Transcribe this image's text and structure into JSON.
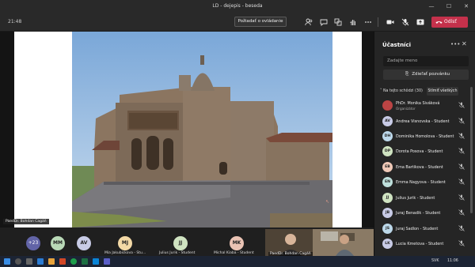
{
  "window": {
    "title": "LD - dejepis - beseda"
  },
  "toolbar": {
    "timer": "21:48",
    "request_label": "Požiadať o ovládanie",
    "leave_label": "Odísť",
    "colors": {
      "leave": "#c4314b"
    }
  },
  "stage": {
    "presenter_tag": "PaedDr. Bohdan Cagáň"
  },
  "strip": {
    "more_count": "+23",
    "avatars": [
      {
        "initials": "MM",
        "name": ""
      },
      {
        "initials": "AV",
        "name": ""
      },
      {
        "initials": "MJ",
        "name": "Mia Jakubickova - Stu..."
      },
      {
        "initials": "JJ",
        "name": "Julius Jurik - Student"
      },
      {
        "initials": "MK",
        "name": "Michal Kiaba - Student"
      }
    ],
    "camera_name": "PaedDr. Bohdan Cagáň"
  },
  "panel": {
    "title": "Účastníci",
    "search_placeholder": "Zadajte meno",
    "share_invite_label": "Zdieľať pozvánku",
    "section_label": "Na tejto schôdzi (30)",
    "mute_all_label": "Stlmiť všetkých",
    "participants": [
      {
        "initials": "",
        "name": "PhDr. Monika Siváková",
        "role": "Organizátor"
      },
      {
        "initials": "AV",
        "name": "Andrea Visnovska - Student",
        "role": ""
      },
      {
        "initials": "DH",
        "name": "Dominika Homolova - Student",
        "role": ""
      },
      {
        "initials": "DP",
        "name": "Dorota Posova - Student",
        "role": ""
      },
      {
        "initials": "EB",
        "name": "Ema Bartikova - Student",
        "role": ""
      },
      {
        "initials": "EN",
        "name": "Emma Nagyova - Student",
        "role": ""
      },
      {
        "initials": "JJ",
        "name": "Julius Jurik - Student",
        "role": ""
      },
      {
        "initials": "JB",
        "name": "Juraj Benadik - Student",
        "role": ""
      },
      {
        "initials": "JS",
        "name": "Juraj Sadlon - Student",
        "role": ""
      },
      {
        "initials": "LK",
        "name": "Lucia Kmetova - Student",
        "role": ""
      }
    ]
  },
  "taskbar": {
    "lang": "SVK",
    "time": "11:06"
  }
}
